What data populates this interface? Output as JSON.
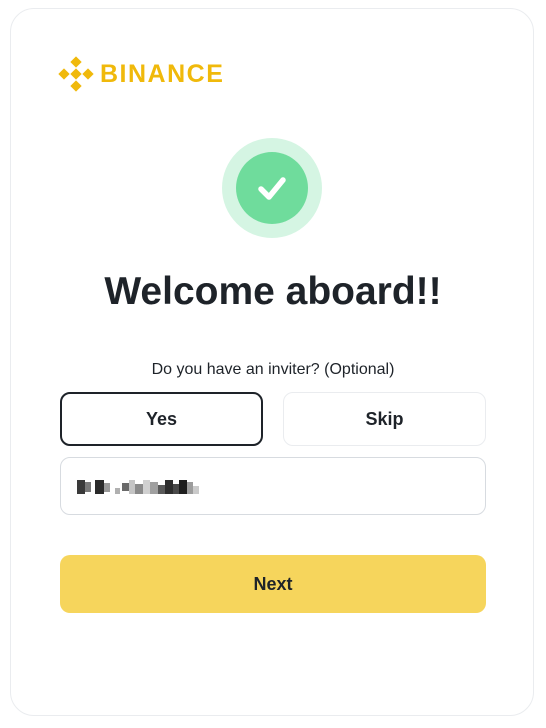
{
  "brand": {
    "name": "BINANCE",
    "icon": "binance-logo-icon",
    "color": "#f0b90b"
  },
  "status": {
    "icon": "checkmark-icon",
    "ring_color": "#d5f5e3",
    "fill_color": "#6fdc9c"
  },
  "main": {
    "title": "Welcome aboard!!",
    "inviter_question": "Do you have an inviter? (Optional)",
    "options": [
      {
        "label": "Yes",
        "selected": true
      },
      {
        "label": "Skip",
        "selected": false
      }
    ],
    "inviter_field": {
      "value_redacted": true
    },
    "next_label": "Next",
    "next_color": "#f6d55c"
  }
}
